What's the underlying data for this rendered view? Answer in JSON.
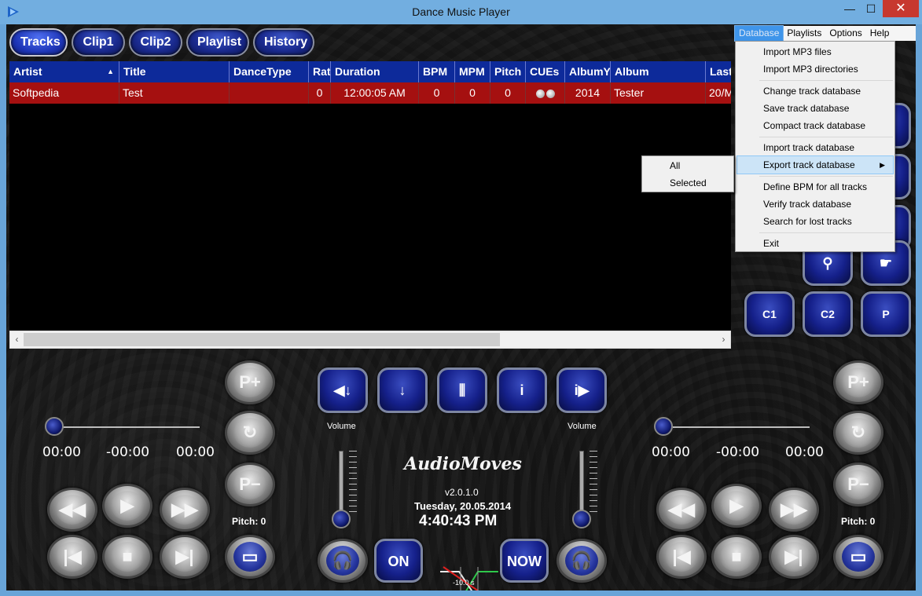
{
  "window": {
    "title": "Dance Music Player",
    "min": "—",
    "max": "☐",
    "close": "✕"
  },
  "tabs": [
    "Tracks",
    "Clip1",
    "Clip2",
    "Playlist",
    "History"
  ],
  "columns": [
    "Artist",
    "Title",
    "DanceType",
    "Rat",
    "Duration",
    "BPM",
    "MPM",
    "Pitch",
    "CUEs",
    "AlbumY",
    "Album",
    "Last"
  ],
  "row": {
    "artist": "Softpedia",
    "title": "Test",
    "dancetype": "",
    "rating": "0",
    "duration": "12:00:05 AM",
    "bpm": "0",
    "mpm": "0",
    "pitch": "0",
    "albumyear": "2014",
    "album": "Tester",
    "last": "20/M"
  },
  "menubar": [
    "Database",
    "Playlists",
    "Options",
    "Help"
  ],
  "db_menu": {
    "import_mp3_files": "Import MP3 files",
    "import_mp3_dirs": "Import MP3 directories",
    "change_db": "Change track database",
    "save_db": "Save track database",
    "compact_db": "Compact track database",
    "import_db": "Import track database",
    "export_db": "Export track database",
    "define_bpm": "Define BPM for all tracks",
    "verify_db": "Verify track database",
    "search_lost": "Search for lost tracks",
    "exit": "Exit"
  },
  "export_submenu": {
    "all": "All",
    "selected": "Selected"
  },
  "left_deck": {
    "pos": "00:00",
    "remain": "-00:00",
    "total": "00:00",
    "pitch_label": "Pitch: 0"
  },
  "right_deck": {
    "pos": "00:00",
    "remain": "-00:00",
    "total": "00:00",
    "pitch_label": "Pitch: 0"
  },
  "center": {
    "volume_left": "Volume",
    "volume_right": "Volume",
    "logo": "AudioMoves",
    "version": "v2.0.1.0",
    "date": "Tuesday, 20.05.2014",
    "clock": "4:40:43 PM",
    "fade_label": "-10.0 s"
  },
  "clip_buttons": {
    "c1": "C1",
    "c2": "C2",
    "p": "P"
  }
}
